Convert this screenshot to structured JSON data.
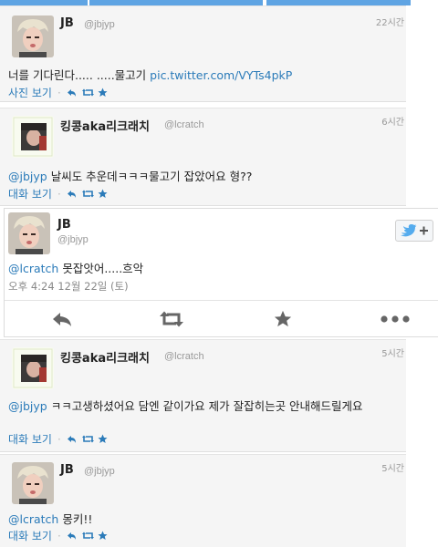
{
  "tweets": [
    {
      "name": "JB",
      "handle": "@jbjyp",
      "time": "22시간",
      "text_plain": "너를 기다린다..... .....물고기 ",
      "link": "pic.twitter.com/VYTs4pkP",
      "action_label": "사진 보기"
    },
    {
      "name": "킹콩aka리크래치",
      "handle": "@lcratch",
      "time": "6시간",
      "mention": "@jbjyp",
      "text_plain": " 날씨도 추운데ㅋㅋㅋ물고기 잡았어요 형??",
      "action_label": "대화 보기"
    },
    {
      "name": "JB",
      "handle": "@jbjyp",
      "mention": "@lcratch",
      "text_plain": " 못잡앗어.....흐악",
      "meta": "오후 4:24 12월 22일 (토)"
    },
    {
      "name": "킹콩aka리크래치",
      "handle": "@lcratch",
      "time": "5시간",
      "mention": "@jbjyp",
      "text_plain": " ㅋㅋ고생하셨어요 담엔 같이가요 제가 잘잡히는곳 안내해드릴게요",
      "action_label": "대화 보기"
    },
    {
      "name": "JB",
      "handle": "@jbjyp",
      "time": "5시간",
      "mention": "@lcratch",
      "text_plain": " 몽키!!",
      "action_label": "대화 보기"
    }
  ],
  "colors": {
    "link": "#2b7bb9",
    "twitter_blue": "#55acee",
    "muted": "#999999"
  },
  "icons": {
    "reply": "reply-icon",
    "retweet": "retweet-icon",
    "favorite": "star-icon",
    "more": "more-icon",
    "follow": "twitter-bird-follow-icon"
  }
}
